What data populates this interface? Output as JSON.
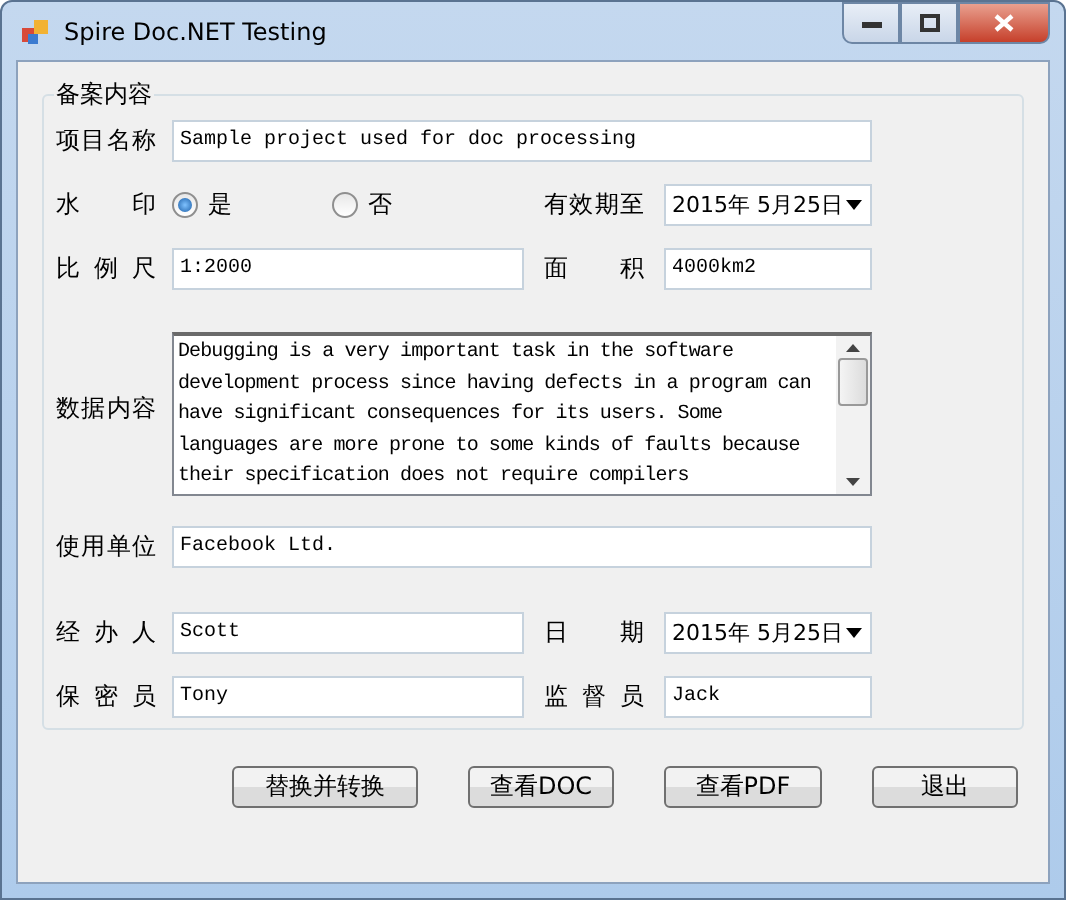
{
  "window": {
    "title": "Spire Doc.NET Testing"
  },
  "group": {
    "title": "备案内容",
    "project_name": {
      "label": "项目名称",
      "value": "Sample project used for doc processing"
    },
    "watermark": {
      "label": "水 印",
      "options": [
        {
          "label": "是",
          "selected": true
        },
        {
          "label": "否",
          "selected": false
        }
      ]
    },
    "valid_until": {
      "label": "有效期至",
      "value": "2015年 5月25日"
    },
    "scale": {
      "label": "比 例 尺",
      "value": "1:2000"
    },
    "area": {
      "label": "面 积",
      "value": "4000km2"
    },
    "data_content": {
      "label": "数据内容",
      "value": "Debugging is a very important task in the software development process since having defects in a program can have significant consequences for its users. Some languages are more prone to some kinds of faults because their specification does not require compilers"
    },
    "user_unit": {
      "label": "使用单位",
      "value": "Facebook Ltd."
    },
    "handler": {
      "label": "经 办 人",
      "value": "Scott"
    },
    "date": {
      "label": "日 期",
      "value": "2015年 5月25日"
    },
    "security_officer": {
      "label": "保 密 员",
      "value": "Tony"
    },
    "supervisor": {
      "label": "监 督 员",
      "value": "Jack"
    }
  },
  "buttons": [
    "替换并转换",
    "查看DOC",
    "查看PDF",
    "退出"
  ]
}
